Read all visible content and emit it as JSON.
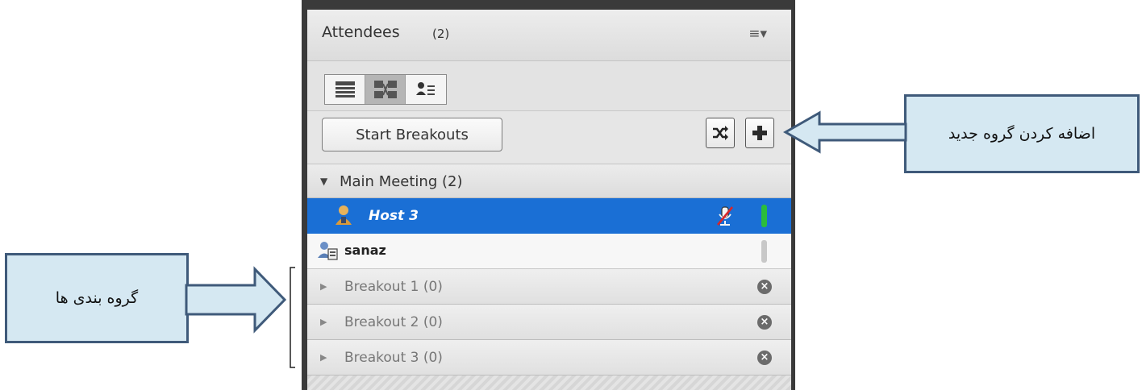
{
  "panel": {
    "title": "Attendees",
    "count": "(2)",
    "menu_icon": "list-menu-icon",
    "view_buttons": [
      {
        "name": "list-view-icon",
        "active": false
      },
      {
        "name": "breakout-view-icon",
        "active": true
      },
      {
        "name": "presenter-view-icon",
        "active": false
      }
    ],
    "start_breakouts_label": "Start Breakouts",
    "shuffle_icon": "shuffle-icon",
    "add_icon": "plus-icon",
    "main_meeting": "Main Meeting (2)",
    "attendees": [
      {
        "name": "Host 3",
        "role": "host",
        "selected": true,
        "mic_muted": true,
        "status_color": "#2bbd3b"
      },
      {
        "name": "sanaz",
        "role": "participant",
        "selected": false,
        "mic_muted": false,
        "status_color": "#c8c8c8"
      }
    ],
    "breakouts": [
      {
        "label": "Breakout 1 (0)"
      },
      {
        "label": "Breakout 2 (0)"
      },
      {
        "label": "Breakout 3 (0)"
      }
    ]
  },
  "callouts": {
    "add_group": "اضافه کردن گروه جدید",
    "groups": "گروه بندی ها"
  },
  "colors": {
    "selected_row": "#1a6fd5",
    "callout_fill": "#d5e8f2",
    "callout_border": "#3f5a7a"
  }
}
